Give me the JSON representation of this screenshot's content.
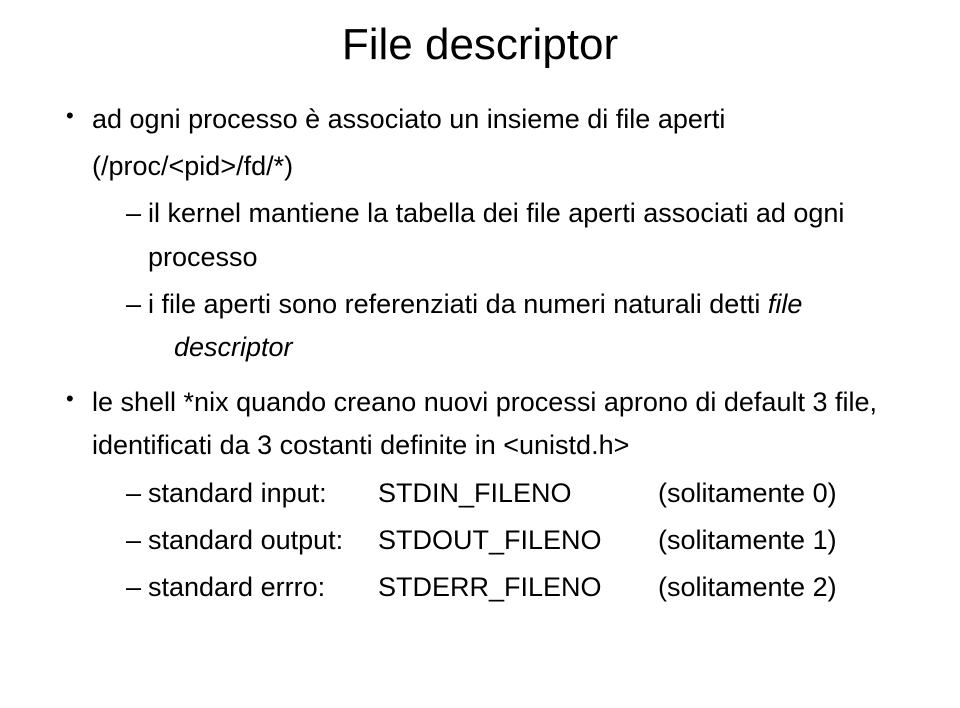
{
  "title": "File descriptor",
  "bullets": {
    "b1": {
      "text": "ad ogni processo è associato un insieme di file aperti",
      "sub1": {
        "paren": "(/proc/<pid>/fd/*)",
        "s1": "il kernel mantiene la tabella dei file aperti associati ad ogni processo",
        "s2_pre": "i file aperti sono referenziati da numeri naturali detti ",
        "s2_em1": "file",
        "s2_em2": "descriptor"
      }
    },
    "b2": {
      "text": "le shell *nix quando creano nuovi processi aprono di default 3 file, identificati da 3 costanti definite in <unistd.h>",
      "stdin": {
        "label": "standard input:",
        "const": "STDIN_FILENO",
        "note": "(solitamente 0)"
      },
      "stdout": {
        "label": "standard output:",
        "const": "STDOUT_FILENO",
        "note": "(solitamente 1)"
      },
      "stderr": {
        "label": "standard errro:",
        "const": "STDERR_FILENO",
        "note": "(solitamente 2)"
      }
    }
  }
}
